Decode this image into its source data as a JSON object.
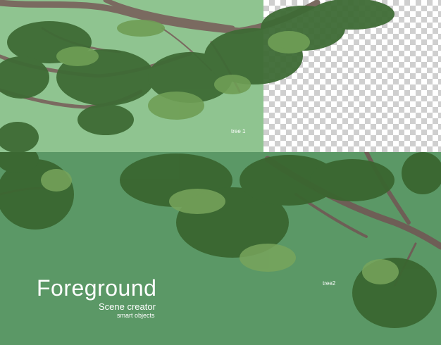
{
  "panels": {
    "top": {
      "label": "tree 1",
      "background": "#8fc490",
      "transparent_region": "checkerboard"
    },
    "bottom": {
      "label": "tree2",
      "background": "#5b9866"
    }
  },
  "caption": {
    "title": "Foreground",
    "subtitle": "Scene creator",
    "tagline": "smart objects"
  },
  "colors": {
    "branch": "#7a6a60",
    "leaf_dark": "#2f5a2c",
    "leaf_mid": "#4d7f3f",
    "leaf_light": "#8fb86a",
    "text": "#ffffff"
  }
}
